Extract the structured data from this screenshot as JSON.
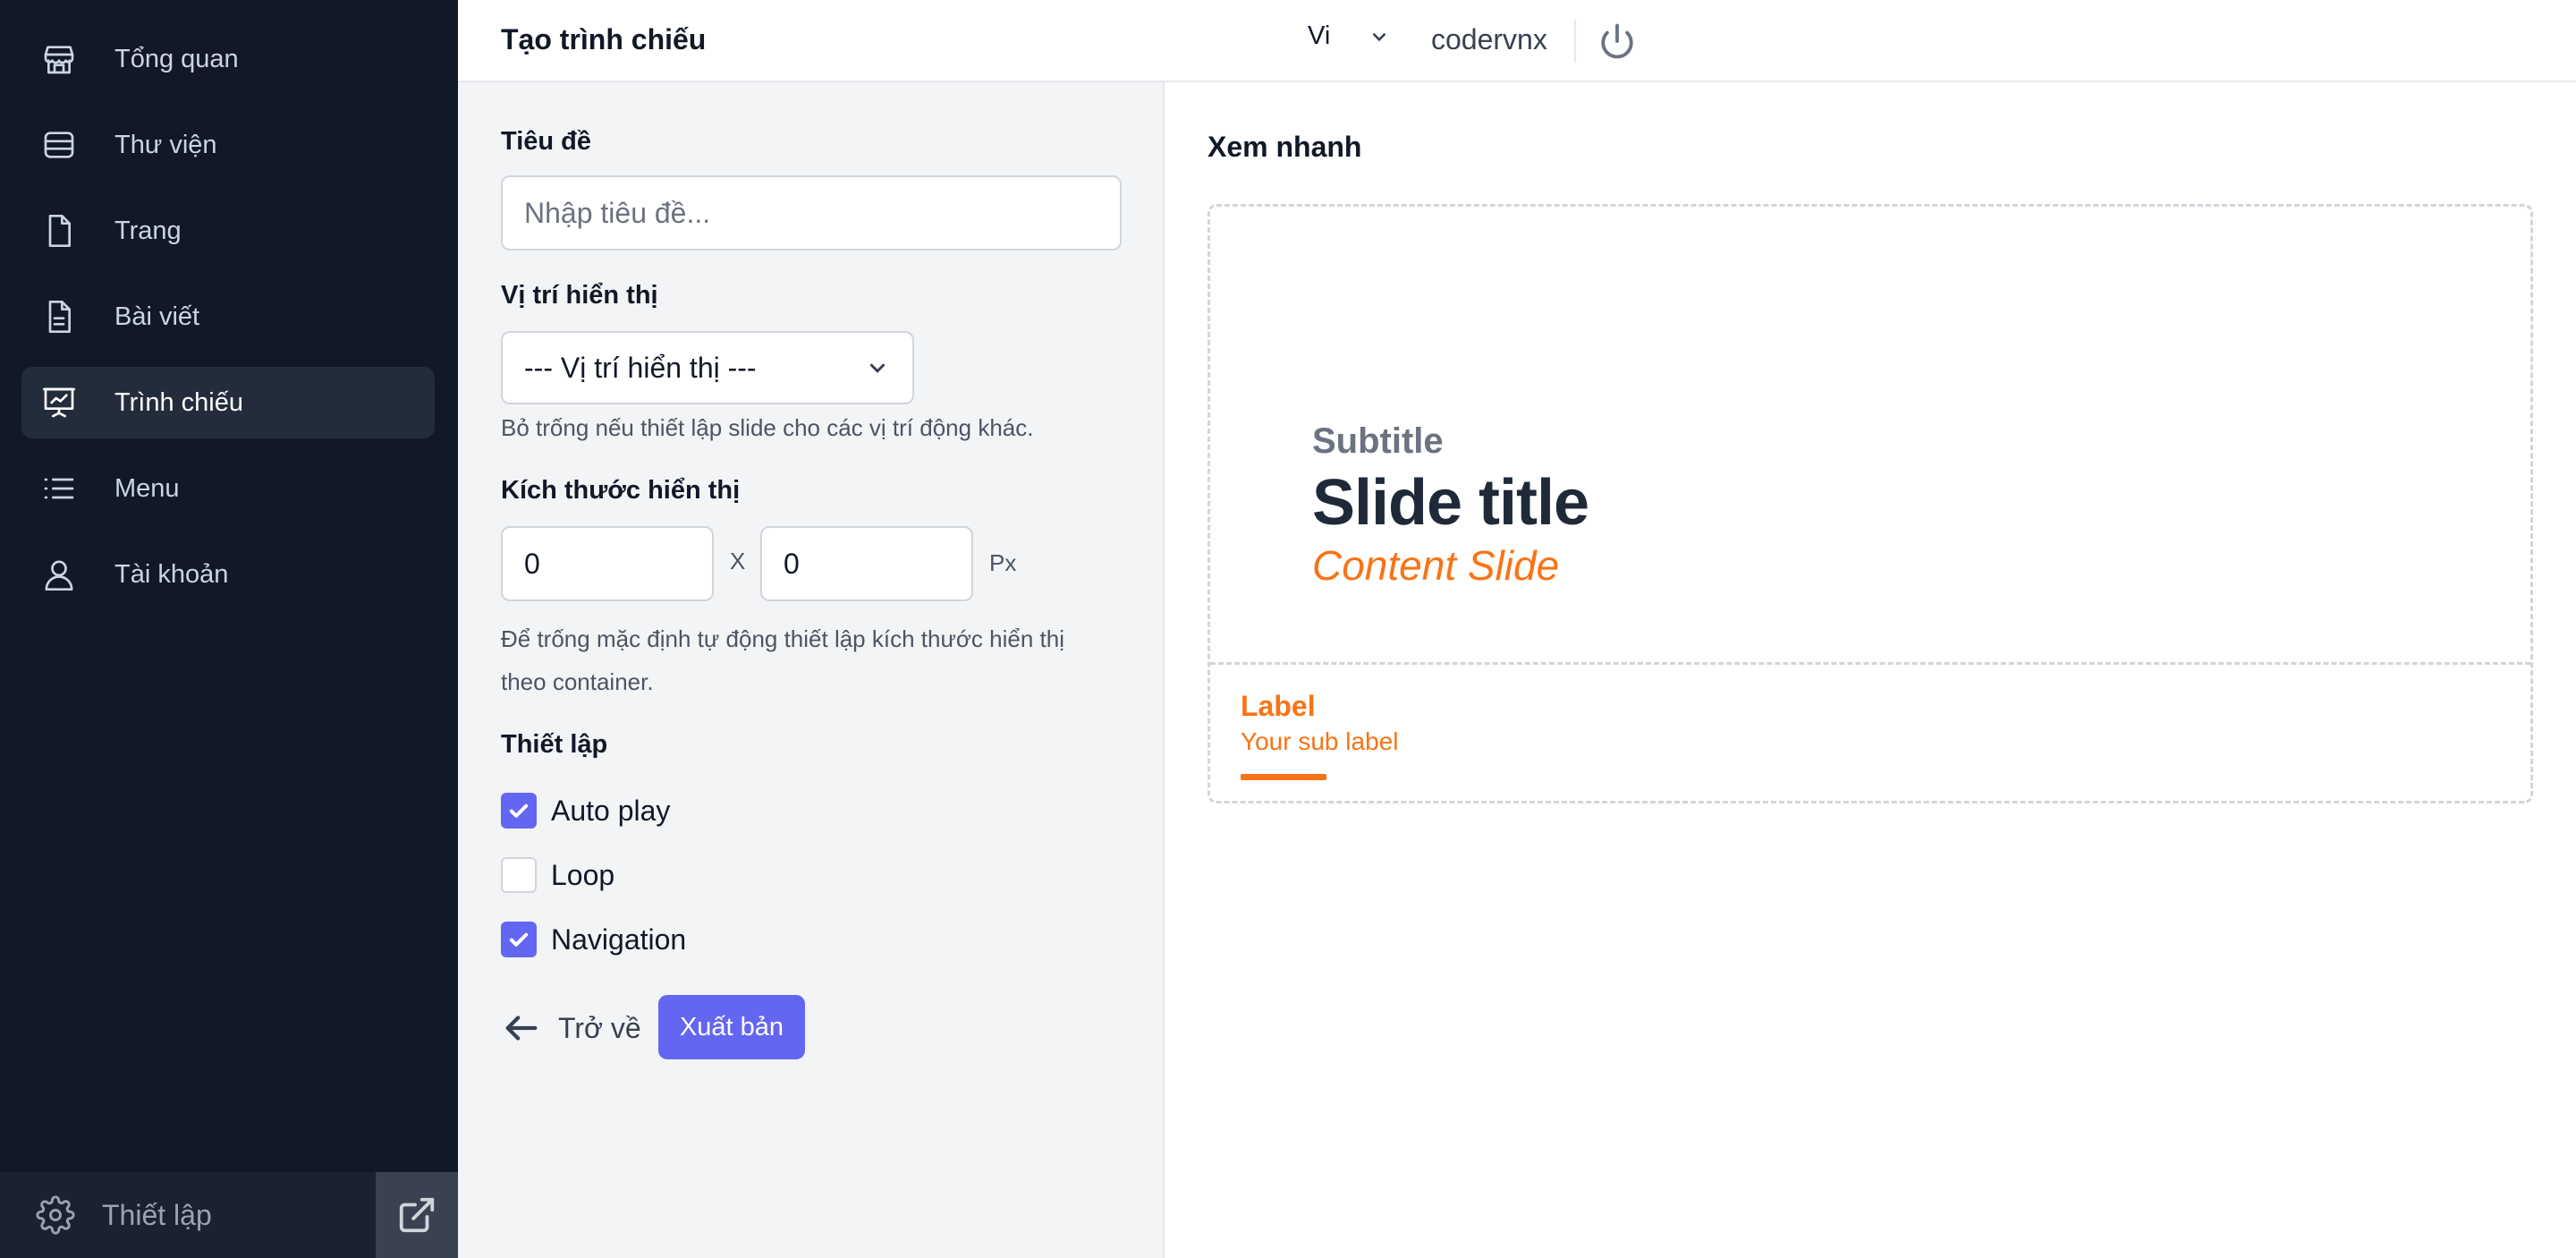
{
  "sidebar": {
    "items": [
      {
        "label": "Tổng quan",
        "icon": "store-icon"
      },
      {
        "label": "Thư viện",
        "icon": "database-icon"
      },
      {
        "label": "Trang",
        "icon": "file-icon"
      },
      {
        "label": "Bài viết",
        "icon": "file-text-icon"
      },
      {
        "label": "Trình chiếu",
        "icon": "presentation-icon",
        "active": true
      },
      {
        "label": "Menu",
        "icon": "list-icon"
      },
      {
        "label": "Tài khoản",
        "icon": "user-icon"
      }
    ],
    "footer": {
      "settings_label": "Thiết lập"
    }
  },
  "header": {
    "title": "Tạo trình chiếu",
    "language": "Vi",
    "username": "codervnx"
  },
  "form": {
    "title_label": "Tiêu đề",
    "title_placeholder": "Nhập tiêu đề...",
    "title_value": "",
    "position_label": "Vị trí hiển thị",
    "position_selected": "--- Vị trí hiển thị ---",
    "position_help": "Bỏ trống nếu thiết lập slide cho các vị trí động khác.",
    "size_label": "Kích thước hiển thị",
    "width_value": "0",
    "height_value": "0",
    "size_separator": "X",
    "size_unit": "Px",
    "size_help_line1": "Để trống mặc định tự động thiết lập kích thước hiển thị",
    "size_help_line2": "theo container.",
    "settings_label": "Thiết lập",
    "options": [
      {
        "label": "Auto play",
        "checked": true
      },
      {
        "label": "Loop",
        "checked": false
      },
      {
        "label": "Navigation",
        "checked": true
      }
    ],
    "back_label": "Trở về",
    "publish_label": "Xuất bản"
  },
  "preview": {
    "title": "Xem nhanh",
    "slide": {
      "subtitle": "Subtitle",
      "title": "Slide title",
      "content": "Content Slide",
      "label": "Label",
      "sub_label": "Your sub label"
    }
  },
  "colors": {
    "sidebar_bg": "#111827",
    "accent": "#6366f1",
    "orange": "#f97316"
  }
}
